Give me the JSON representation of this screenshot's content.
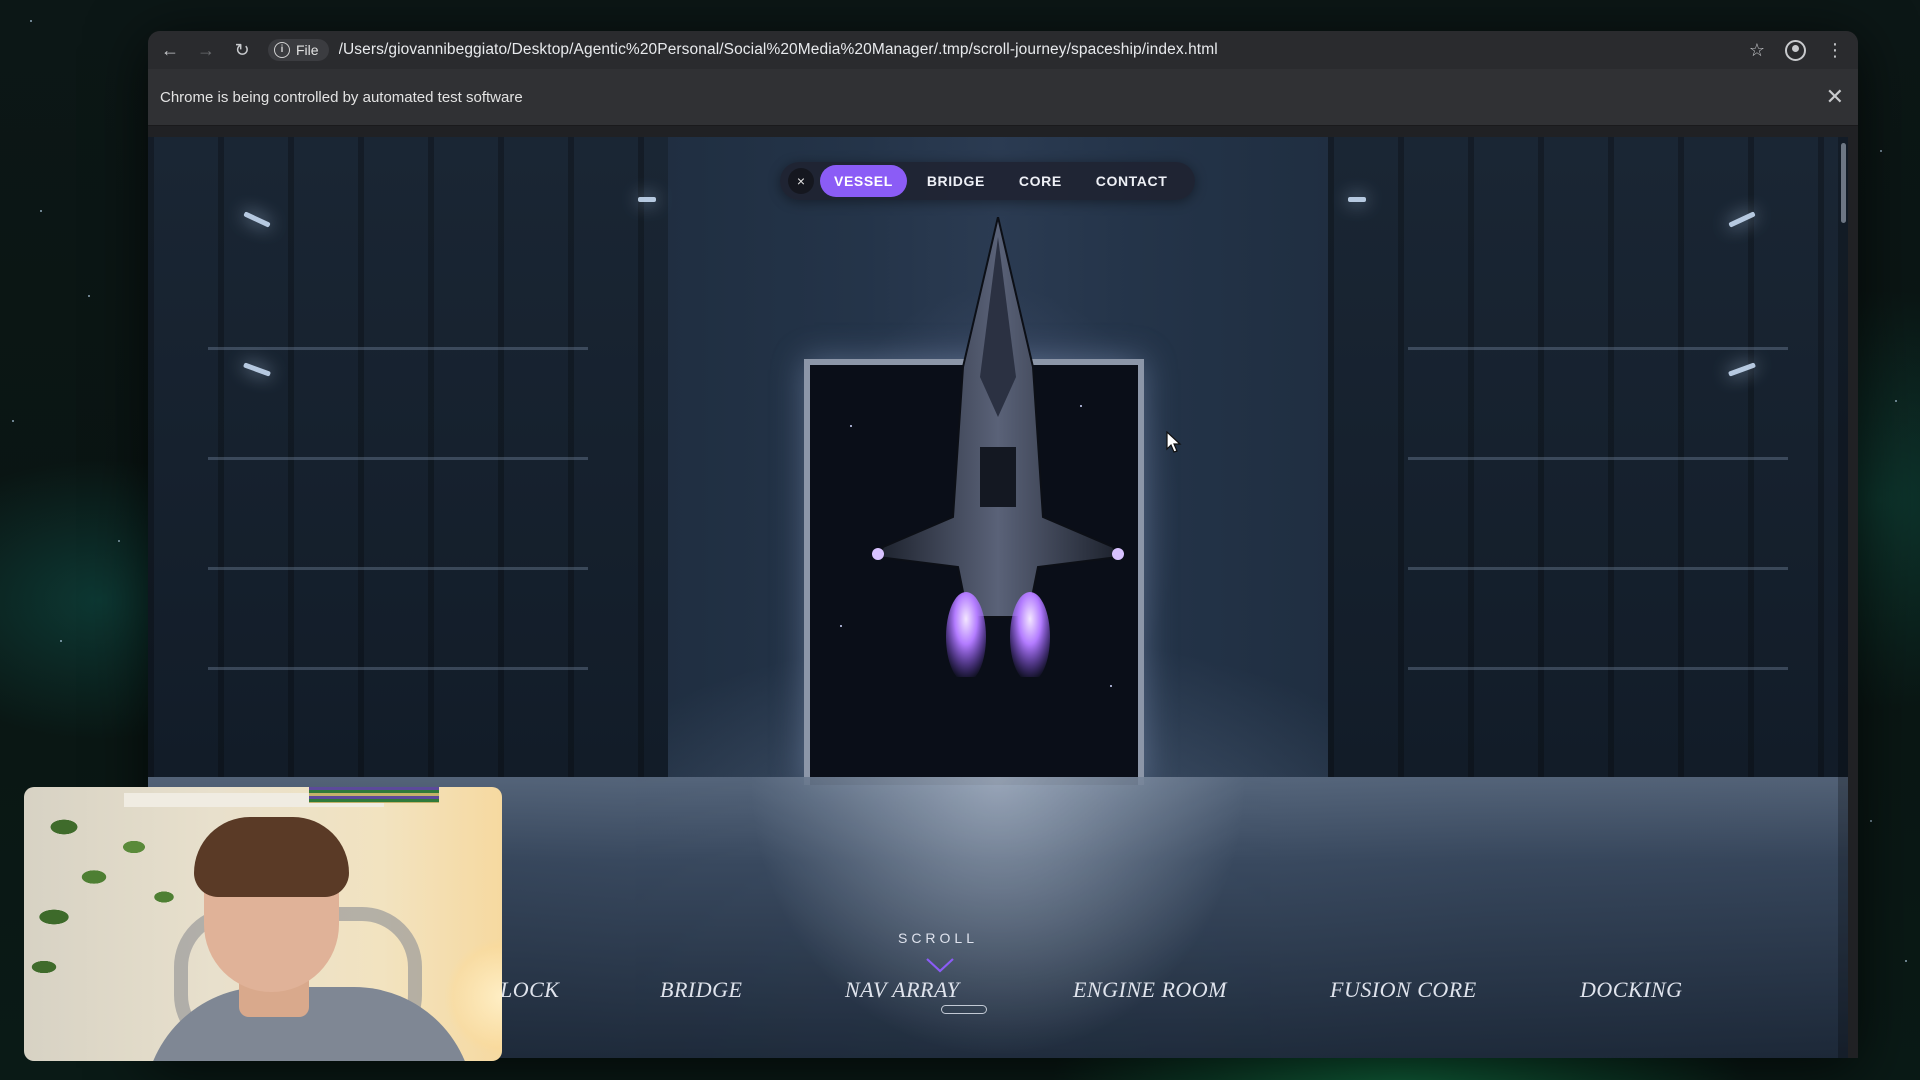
{
  "browser": {
    "site_info_label": "File",
    "url": "/Users/giovannibeggiato/Desktop/Agentic%20Personal/Social%20Media%20Manager/.tmp/scroll-journey/spaceship/index.html",
    "infobar_text": "Chrome is being controlled by automated test software"
  },
  "icons": {
    "back": "arrow-left-icon",
    "forward": "arrow-right-icon",
    "reload": "reload-icon",
    "info": "info-icon",
    "bookmark": "star-icon",
    "profile": "profile-icon",
    "menu": "kebab-menu-icon",
    "close": "close-icon",
    "chevron": "chevron-down-icon"
  },
  "nav": {
    "close_glyph": "×",
    "items": [
      "VESSEL",
      "BRIDGE",
      "CORE",
      "CONTACT"
    ],
    "active": "VESSEL"
  },
  "scroll_prompt": "SCROLL",
  "sections": [
    "LOCK",
    "BRIDGE",
    "NAV ARRAY",
    "ENGINE ROOM",
    "FUSION CORE",
    "DOCKING"
  ],
  "colors": {
    "accent": "#8b5cf6",
    "engine_glow": "#b37cff"
  }
}
